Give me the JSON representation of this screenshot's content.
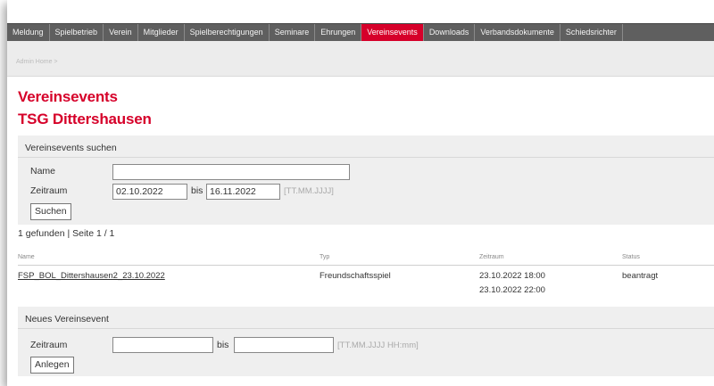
{
  "nav": {
    "items": [
      {
        "label": "Meldung",
        "active": false
      },
      {
        "label": "Spielbetrieb",
        "active": false
      },
      {
        "label": "Verein",
        "active": false
      },
      {
        "label": "Mitglieder",
        "active": false
      },
      {
        "label": "Spielberechtigungen",
        "active": false
      },
      {
        "label": "Seminare",
        "active": false
      },
      {
        "label": "Ehrungen",
        "active": false
      },
      {
        "label": "Vereinsevents",
        "active": true
      },
      {
        "label": "Downloads",
        "active": false
      },
      {
        "label": "Verbandsdokumente",
        "active": false
      },
      {
        "label": "Schiedsrichter",
        "active": false
      }
    ]
  },
  "breadcrumb": "Admin Home >",
  "page": {
    "title": "Vereinsevents",
    "subtitle": "TSG Dittershausen"
  },
  "search": {
    "heading": "Vereinsevents suchen",
    "name_label": "Name",
    "name_value": "",
    "period_label": "Zeitraum",
    "from_value": "02.10.2022",
    "to_label": "bis",
    "to_value": "16.11.2022",
    "format_hint": "[TT.MM.JJJJ]",
    "button": "Suchen"
  },
  "results": {
    "summary": "1 gefunden | Seite 1 / 1",
    "columns": [
      "Name",
      "Typ",
      "Zeitraum",
      "Status"
    ],
    "rows": [
      {
        "name": "FSP_BOL_Dittershausen2_23.10.2022",
        "type": "Freundschaftsspiel",
        "start": "23.10.2022 18:00",
        "end": "23.10.2022 22:00",
        "status": "beantragt"
      }
    ]
  },
  "new_event": {
    "heading": "Neues Vereinsevent",
    "period_label": "Zeitraum",
    "from_value": "",
    "to_label": "bis",
    "to_value": "",
    "format_hint": "[TT.MM.JJJJ HH:mm]",
    "button": "Anlegen"
  },
  "colors": {
    "accent": "#d6002a",
    "nav_bg": "#5f5f5f",
    "panel_bg": "#efefef"
  }
}
